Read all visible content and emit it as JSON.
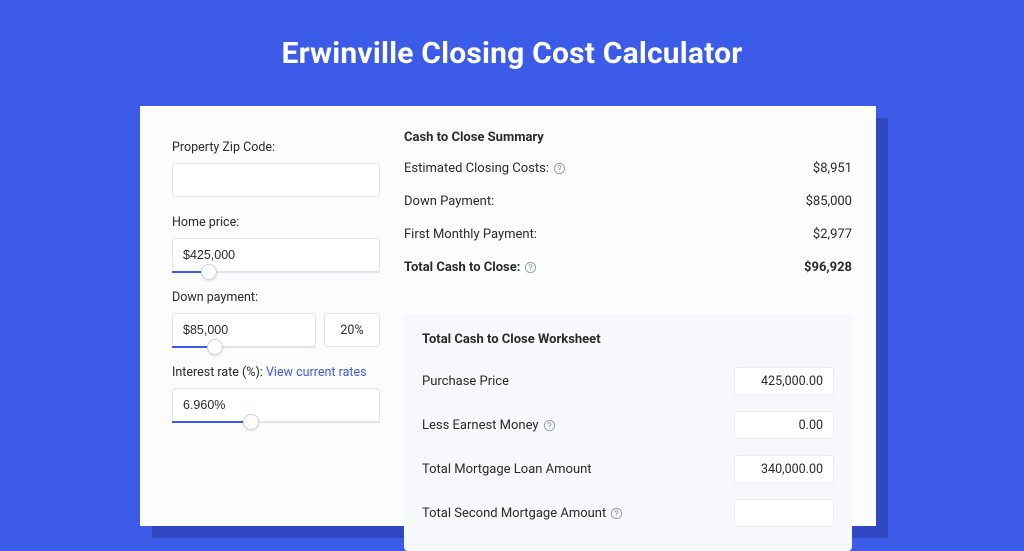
{
  "page_title": "Erwinville Closing Cost Calculator",
  "left": {
    "zip_label": "Property Zip Code:",
    "zip_value": "",
    "home_price_label": "Home price:",
    "home_price_value": "$425,000",
    "down_payment_label": "Down payment:",
    "down_payment_value": "$85,000",
    "down_payment_pct": "20%",
    "interest_label": "Interest rate (%):",
    "interest_link": "View current rates",
    "interest_value": "6.960%"
  },
  "summary": {
    "heading": "Cash to Close Summary",
    "rows": [
      {
        "label": "Estimated Closing Costs:",
        "value": "$8,951",
        "help": true
      },
      {
        "label": "Down Payment:",
        "value": "$85,000",
        "help": false
      },
      {
        "label": "First Monthly Payment:",
        "value": "$2,977",
        "help": false
      }
    ],
    "total_label": "Total Cash to Close:",
    "total_value": "$96,928"
  },
  "worksheet": {
    "heading": "Total Cash to Close Worksheet",
    "rows": [
      {
        "label": "Purchase Price",
        "value": "425,000.00",
        "help": false
      },
      {
        "label": "Less Earnest Money",
        "value": "0.00",
        "help": true
      },
      {
        "label": "Total Mortgage Loan Amount",
        "value": "340,000.00",
        "help": false
      },
      {
        "label": "Total Second Mortgage Amount",
        "value": "",
        "help": true
      }
    ]
  }
}
